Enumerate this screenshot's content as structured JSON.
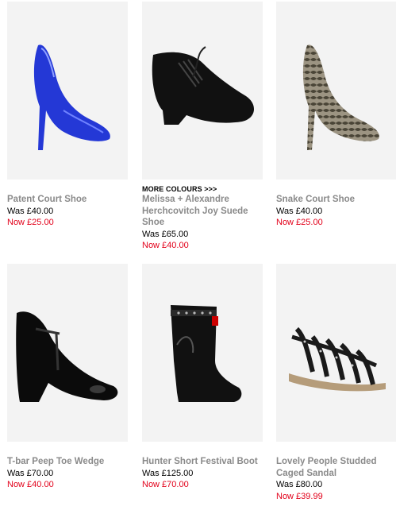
{
  "products": [
    {
      "name": "Patent Court Shoe",
      "was": "Was £40.00",
      "now": "Now £25.00",
      "image_icon": "blue-patent-court-shoe"
    },
    {
      "name": "Melissa + Alexandre Herchcovitch Joy Suede Shoe",
      "more_colours": "MORE COLOURS >>>",
      "was": "Was £65.00",
      "now": "Now £40.00",
      "image_icon": "black-suede-lace-up-shoe"
    },
    {
      "name": "Snake Court Shoe",
      "was": "Was £40.00",
      "now": "Now £25.00",
      "image_icon": "snakeskin-court-shoe"
    },
    {
      "name": "T-bar Peep Toe Wedge",
      "was": "Was £70.00",
      "now": "Now £40.00",
      "image_icon": "black-tbar-wedge"
    },
    {
      "name": "Hunter Short Festival Boot",
      "was": "Was £125.00",
      "now": "Now £70.00",
      "image_icon": "black-short-boot"
    },
    {
      "name": "Lovely People Studded Caged Sandal",
      "was": "Was £80.00",
      "now": "Now £39.99",
      "image_icon": "studded-caged-sandal"
    }
  ],
  "colors": {
    "sale_red": "#e2001a",
    "name_grey": "#8a8a8a",
    "image_bg": "#f3f3f3"
  }
}
